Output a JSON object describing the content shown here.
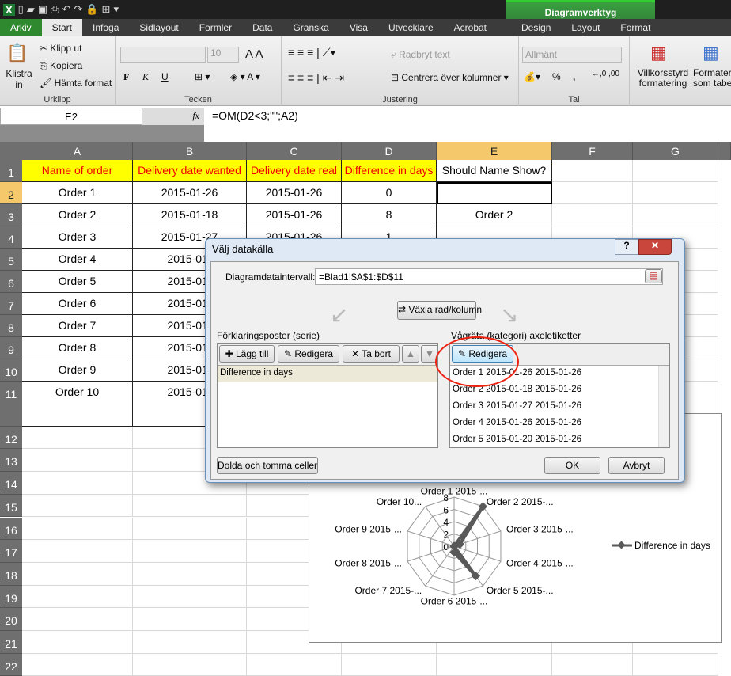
{
  "window": {
    "context_group": "Diagramverktyg",
    "tabs": [
      "Arkiv",
      "Start",
      "Infoga",
      "Sidlayout",
      "Formler",
      "Data",
      "Granska",
      "Visa",
      "Utvecklare",
      "Acrobat",
      "Design",
      "Layout",
      "Format"
    ],
    "active_tab": "Start"
  },
  "ribbon": {
    "urklipp": {
      "label": "Urklipp",
      "paste": "Klistra in",
      "cut": "Klipp ut",
      "copy": "Kopiera",
      "format_painter": "Hämta format"
    },
    "tecken": {
      "label": "Tecken",
      "font": "",
      "size": "10",
      "bold": "F",
      "italic": "K",
      "underline": "U"
    },
    "justering": {
      "label": "Justering",
      "wrap": "Radbryt text",
      "merge": "Centrera över kolumner"
    },
    "tal": {
      "label": "Tal",
      "format": "Allmänt",
      "percent": "%",
      "comma": ","
    },
    "styles": {
      "conditional": "Villkorsstyrd formatering",
      "table": "Formatera som tabell"
    }
  },
  "formula_bar": {
    "name_box": "E2",
    "fx": "fx",
    "formula": "=OM(D2<3;\"\";A2)"
  },
  "sheet": {
    "columns": [
      "A",
      "B",
      "C",
      "D",
      "E",
      "F",
      "G"
    ],
    "rows": [
      "1",
      "2",
      "3",
      "4",
      "5",
      "6",
      "7",
      "8",
      "9",
      "10",
      "11",
      "12",
      "13",
      "14",
      "15",
      "16",
      "17",
      "18",
      "19",
      "20",
      "21",
      "22"
    ],
    "header": [
      "Name of order",
      "Delivery date wanted",
      "Delivery date real",
      "Difference in days",
      "Should Name Show?"
    ],
    "data": [
      [
        "Order 1",
        "2015-01-26",
        "2015-01-26",
        "0",
        ""
      ],
      [
        "Order 2",
        "2015-01-18",
        "2015-01-26",
        "8",
        "Order 2"
      ],
      [
        "Order 3",
        "2015-01-27",
        "2015-01-26",
        "1",
        ""
      ],
      [
        "Order 4",
        "2015-01-",
        "",
        "",
        ""
      ],
      [
        "Order 5",
        "2015-01-",
        "",
        "",
        ""
      ],
      [
        "Order 6",
        "2015-01-",
        "",
        "",
        ""
      ],
      [
        "Order 7",
        "2015-01-",
        "",
        "",
        ""
      ],
      [
        "Order 8",
        "2015-01-",
        "",
        "",
        ""
      ],
      [
        "Order 9",
        "2015-01-",
        "",
        "",
        ""
      ],
      [
        "Order 10",
        "2015-01-",
        "",
        "",
        ""
      ]
    ]
  },
  "dialog": {
    "title": "Välj datakälla",
    "help": "?",
    "close": "✕",
    "range_label": "Diagramdataintervall:",
    "range_value": "=Blad1!$A$1:$D$11",
    "switch": "Växla rad/kolumn",
    "series_label": "Förklaringsposter (serie)",
    "add": "Lägg till",
    "edit": "Redigera",
    "remove": "Ta bort",
    "series": [
      "Difference in days"
    ],
    "category_label": "Vågräta (kategori) axeletiketter",
    "cat_edit": "Redigera",
    "categories": [
      "Order 1 2015-01-26 2015-01-26",
      "Order 2 2015-01-18 2015-01-26",
      "Order 3 2015-01-27 2015-01-26",
      "Order 4 2015-01-26 2015-01-26",
      "Order 5 2015-01-20 2015-01-26"
    ],
    "hidden": "Dolda och tomma celler",
    "ok": "OK",
    "cancel": "Avbryt"
  },
  "chart_data": {
    "type": "radar",
    "categories": [
      "Order 1 2015-...",
      "Order 2 2015-...",
      "Order 3 2015-...",
      "Order 4 2015-...",
      "Order 5 2015-...",
      "Order 6 2015-...",
      "Order 7 2015-...",
      "Order 8 2015-...",
      "Order 9 2015-...",
      "Order 10..."
    ],
    "series": [
      {
        "name": "Difference in days",
        "values": [
          0,
          8,
          1,
          0,
          6,
          1,
          0,
          0,
          0,
          0
        ],
        "color": "#595959"
      }
    ],
    "ticks": [
      "0",
      "2",
      "4",
      "6",
      "8"
    ],
    "ylim": [
      0,
      8
    ],
    "legend": "right",
    "grid": true
  }
}
